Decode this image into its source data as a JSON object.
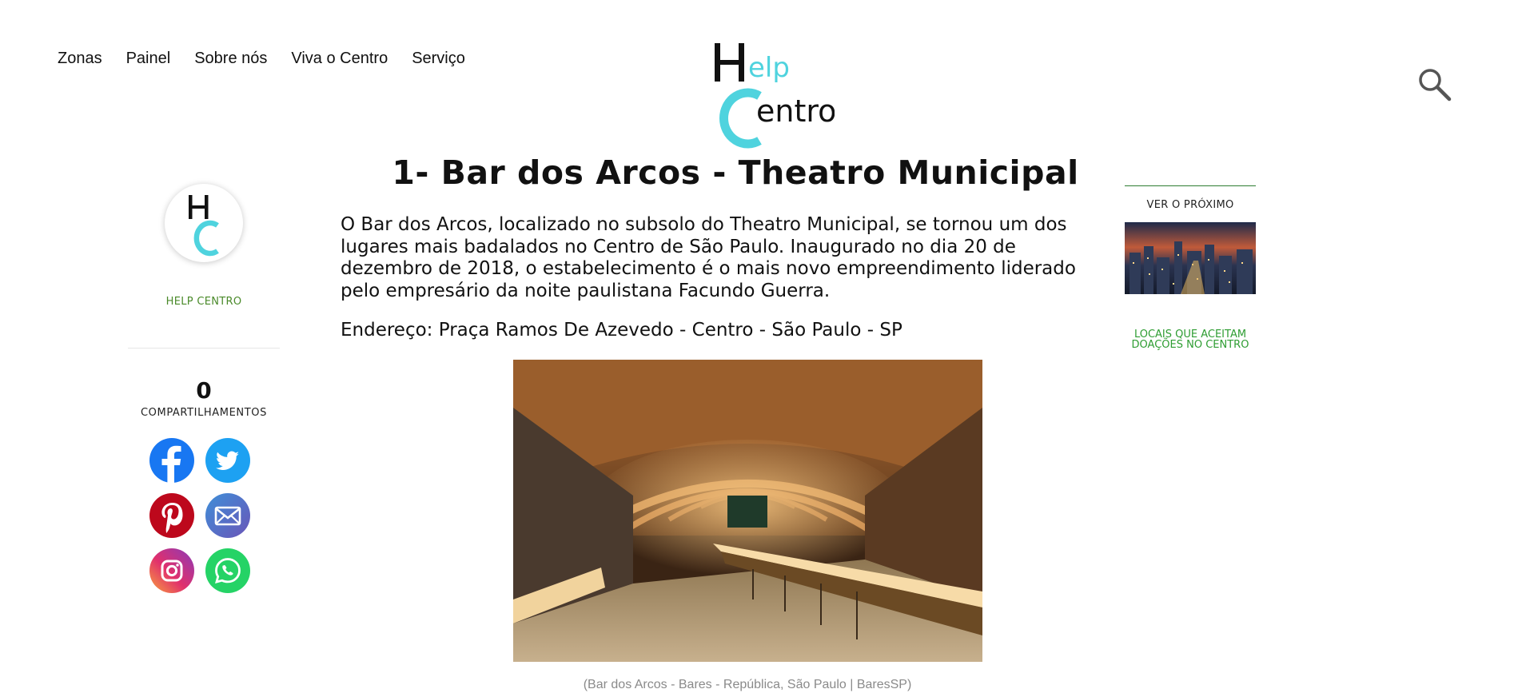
{
  "nav": {
    "items": [
      "Zonas",
      "Painel",
      "Sobre nós",
      "Viva o Centro",
      "Serviço"
    ]
  },
  "logo": {
    "part1": "elp",
    "part2": "entro",
    "colors": {
      "dark": "#111111",
      "accent": "#4fd3de"
    }
  },
  "sidebar": {
    "author": "HELP CENTRO",
    "share_count": "0",
    "share_label": "COMPARTILHAMENTOS",
    "socials": [
      {
        "name": "facebook",
        "icon": "facebook-icon",
        "color": "#1877f2"
      },
      {
        "name": "twitter",
        "icon": "twitter-bird-icon",
        "color": "#1da1f2"
      },
      {
        "name": "pinterest",
        "icon": "pinterest-icon",
        "color": "#bd081c"
      },
      {
        "name": "email",
        "icon": "envelope-icon",
        "color": "#5b6bc6"
      },
      {
        "name": "instagram",
        "icon": "instagram-icon",
        "color": "#d62976"
      },
      {
        "name": "whatsapp",
        "icon": "whatsapp-icon",
        "color": "#25d366"
      }
    ]
  },
  "article": {
    "title": "1- Bar dos Arcos - Theatro Municipal",
    "paragraph": "O Bar dos Arcos, localizado no subsolo do Theatro Municipal, se tornou um dos lugares mais badalados no Centro de São Paulo. Inaugurado  no dia 20 de dezembro de 2018, o estabelecimento é o mais novo empreendimento liderado pelo empresário da noite paulistana Facundo Guerra.",
    "address": "Endereço: Praça Ramos De Azevedo - Centro - São Paulo - SP",
    "caption": "(Bar dos Arcos - Bares - República, São Paulo | BaresSP)"
  },
  "right": {
    "next_label": "VER O PRÓXIMO",
    "link": "LOCAIS QUE ACEITAM DOAÇÕES NO CENTRO"
  }
}
